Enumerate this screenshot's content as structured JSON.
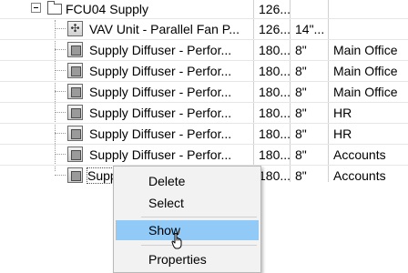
{
  "tree": {
    "root": {
      "name": "FCU04 Supply",
      "c1": "126..."
    },
    "rows": [
      {
        "icon": "fan",
        "name": "VAV Unit - Parallel Fan P...",
        "c1": "126...",
        "c2": "14\"...",
        "c3": ""
      },
      {
        "icon": "diffuser",
        "name": "Supply Diffuser - Perfor...",
        "c1": "180...",
        "c2": "8\"",
        "c3": "Main Office"
      },
      {
        "icon": "diffuser",
        "name": "Supply Diffuser - Perfor...",
        "c1": "180...",
        "c2": "8\"",
        "c3": "Main Office"
      },
      {
        "icon": "diffuser",
        "name": "Supply Diffuser - Perfor...",
        "c1": "180...",
        "c2": "8\"",
        "c3": "Main Office"
      },
      {
        "icon": "diffuser",
        "name": "Supply Diffuser - Perfor...",
        "c1": "180...",
        "c2": "8\"",
        "c3": "HR"
      },
      {
        "icon": "diffuser",
        "name": "Supply Diffuser - Perfor...",
        "c1": "180...",
        "c2": "8\"",
        "c3": "HR"
      },
      {
        "icon": "diffuser",
        "name": "Supply Diffuser - Perfor...",
        "c1": "180...",
        "c2": "8\"",
        "c3": "Accounts"
      },
      {
        "icon": "diffuser",
        "name": "Supply Diffuser - Perfor...",
        "c1": "180...",
        "c2": "8\"",
        "c3": "Accounts"
      }
    ]
  },
  "context_menu": {
    "items": [
      "Delete",
      "Select",
      "Show",
      "Properties"
    ],
    "highlighted": "Show"
  }
}
